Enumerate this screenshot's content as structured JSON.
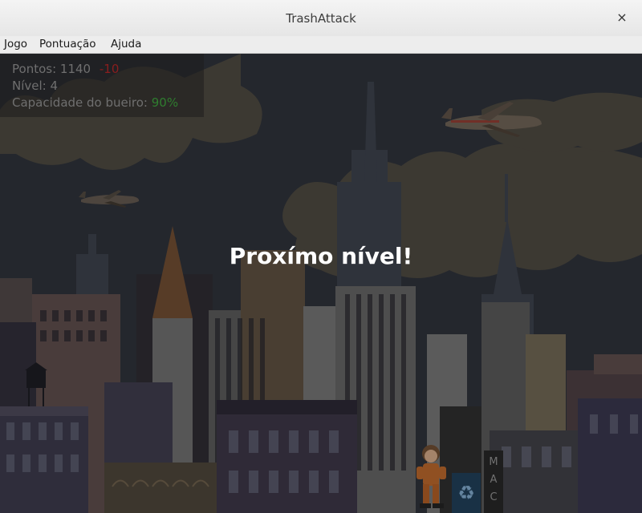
{
  "window": {
    "title": "TrashAttack",
    "close_symbol": "×"
  },
  "menu": {
    "items": [
      "Jogo",
      "Pontuação",
      "Ajuda"
    ]
  },
  "hud": {
    "points_label": "Pontos:",
    "points_value": "1140",
    "points_delta": "-10",
    "level_label": "Nível:",
    "level_value": "4",
    "capacity_label": "Capacidade do bueiro:",
    "capacity_value": "90%"
  },
  "overlay": {
    "message": "Proxímo nível!"
  },
  "billboard_letters": "MAC",
  "colors": {
    "sky": "#2c3038",
    "cloud": "#4e4a40",
    "delta": "#8a1e1e",
    "capacity": "#2f7d2f",
    "hud_text": "#6f6f6f"
  },
  "icons": [
    "close-icon",
    "airplane-icon",
    "recycle-icon",
    "player-character"
  ]
}
